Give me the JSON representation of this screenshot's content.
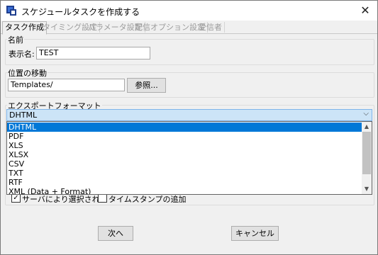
{
  "window": {
    "title": "スケジュールタスクを作成する",
    "close_glyph": "✕",
    "icon": "app-icon"
  },
  "tabs": [
    {
      "label": "タスク作成",
      "active": true
    },
    {
      "label": "タイミング設定",
      "active": false
    },
    {
      "label": "パラメータ設定",
      "active": false
    },
    {
      "label": "配信オプション設定",
      "active": false
    },
    {
      "label": "受信者",
      "active": false
    }
  ],
  "name_group": {
    "title": "名前",
    "display_name_label": "表示名:",
    "display_name_value": "TEST"
  },
  "location_group": {
    "title": "位置の移動",
    "path_value": "Templates/",
    "browse_label": "参照..."
  },
  "export_group": {
    "title": "エクスポートフォーマット",
    "selected": "DHTML",
    "options": [
      "DHTML",
      "PDF",
      "XLS",
      "XLSX",
      "CSV",
      "TXT",
      "RTF",
      "XML (Data + Format)"
    ]
  },
  "checkboxes": {
    "server_selected_label": "サーバにより選択された",
    "server_selected_checked": true,
    "timestamp_label": "タイムスタンプの追加",
    "timestamp_checked": false
  },
  "footer": {
    "next_label": "次へ",
    "cancel_label": "キャンセル"
  },
  "colors": {
    "selection": "#0078d7",
    "combo_bg": "#cce4f7",
    "window_bg": "#f0f0f0"
  }
}
